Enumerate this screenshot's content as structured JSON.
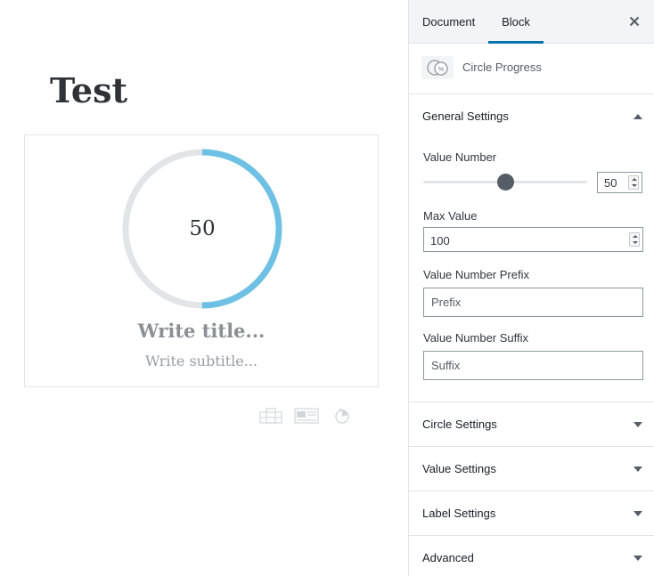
{
  "editor": {
    "post_title": "Test",
    "block": {
      "circle_value": "50",
      "title_placeholder": "Write title...",
      "subtitle_placeholder": "Write subtitle...",
      "progress_percent": 50,
      "colors": {
        "track": "#e2e4e7",
        "progress": "#6ec1e4"
      }
    },
    "toolbar_icons": [
      "alignment-icon",
      "media-text-icon",
      "timer-icon"
    ]
  },
  "sidebar": {
    "tabs": [
      {
        "label": "Document",
        "active": false
      },
      {
        "label": "Block",
        "active": true
      }
    ],
    "close_icon": "close-icon",
    "block_card": {
      "title": "Circle Progress",
      "icon": "circle-progress-icon"
    },
    "general_settings": {
      "title": "General Settings",
      "expanded": true,
      "value_number": {
        "label": "Value Number",
        "value": "50",
        "slider_fraction": 0.5
      },
      "max_value": {
        "label": "Max Value",
        "value": "100"
      },
      "prefix": {
        "label": "Value Number Prefix",
        "placeholder": "Prefix"
      },
      "suffix": {
        "label": "Value Number Suffix",
        "placeholder": "Suffix"
      }
    },
    "panels": [
      {
        "title": "Circle Settings",
        "expanded": false
      },
      {
        "title": "Value Settings",
        "expanded": false
      },
      {
        "title": "Label Settings",
        "expanded": false
      },
      {
        "title": "Advanced",
        "expanded": false
      }
    ],
    "accent_color": "#0073aa"
  }
}
